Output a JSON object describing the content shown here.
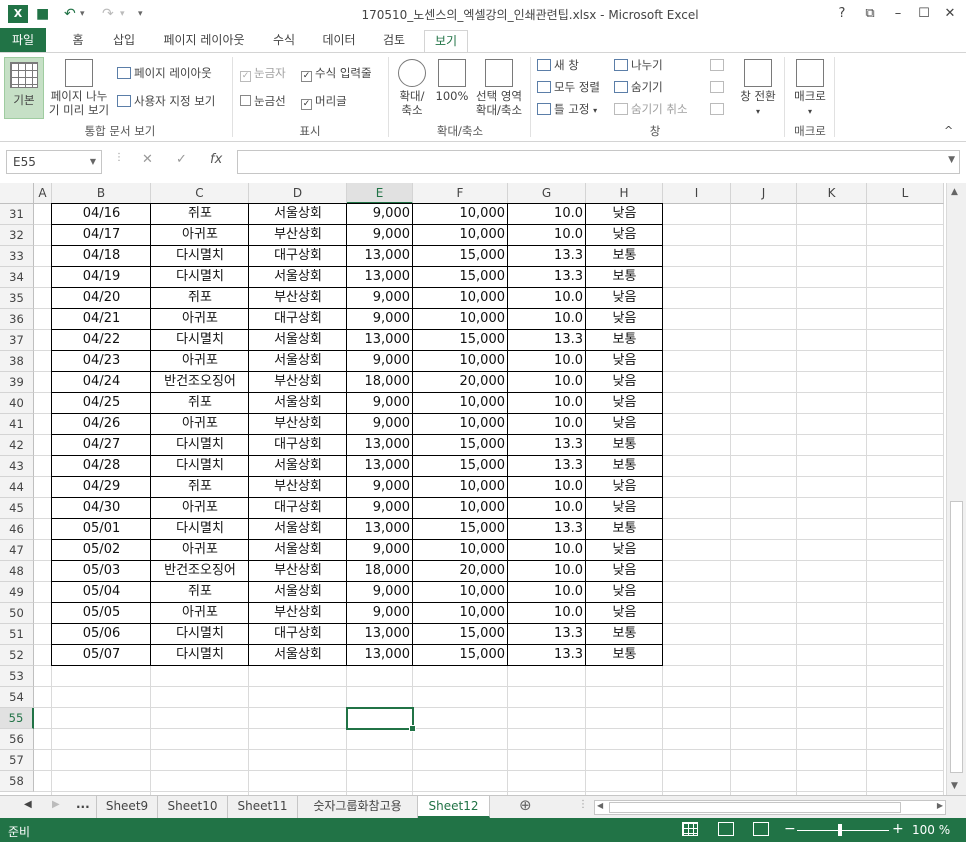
{
  "window": {
    "title": "170510_노센스의_엑셀강의_인쇄관련팁.xlsx - Microsoft Excel",
    "app_icon": "X",
    "help": "?",
    "restore_ribbon": "⧉",
    "minimize": "–",
    "maximize": "☐",
    "close": "✕"
  },
  "quick_access": {
    "save_icon": "💾",
    "undo": "↶",
    "redo": "↷",
    "more": "▾"
  },
  "tabs": [
    "파일",
    "홈",
    "삽입",
    "페이지 레이아웃",
    "수식",
    "데이터",
    "검토",
    "보기"
  ],
  "active_tab": "보기",
  "ribbon": {
    "workbook_views": {
      "label": "통합 문서 보기",
      "normal": "기본",
      "page_break_preview_1": "페이지 나누",
      "page_break_preview_2": "기 미리 보기",
      "page_layout": "페이지 레이아웃",
      "custom_views": "사용자 지정 보기"
    },
    "show": {
      "label": "표시",
      "ruler": "눈금자",
      "formula_bar": "수식 입력줄",
      "gridlines": "눈금선",
      "headings": "머리글"
    },
    "zoom": {
      "label": "확대/축소",
      "zoom_1": "확대/",
      "zoom_2": "축소",
      "hundred": "100%",
      "zoom_sel_1": "선택 영역",
      "zoom_sel_2": "확대/축소"
    },
    "window": {
      "label": "창",
      "new_window": "새 창",
      "arrange_all": "모두 정렬",
      "freeze": "틀 고정",
      "split": "나누기",
      "hide": "숨기기",
      "unhide": "숨기기 취소",
      "switch_1": "창 전환"
    },
    "macros": {
      "label": "매크로",
      "macros": "매크로"
    },
    "collapse": "^"
  },
  "formula_bar": {
    "name_box": "E55",
    "cancel": "✕",
    "enter": "✓",
    "fx": "fx",
    "value": ""
  },
  "columns": [
    "A",
    "B",
    "C",
    "D",
    "E",
    "F",
    "G",
    "H",
    "I",
    "J",
    "K",
    "L"
  ],
  "selected_column": "E",
  "selected_row": "55",
  "rows_labels": [
    "31",
    "32",
    "33",
    "34",
    "35",
    "36",
    "37",
    "38",
    "39",
    "40",
    "41",
    "42",
    "43",
    "44",
    "45",
    "46",
    "47",
    "48",
    "49",
    "50",
    "51",
    "52",
    "53",
    "54",
    "55",
    "56",
    "57",
    "58"
  ],
  "table_rows": [
    [
      "04/16",
      "쥐포",
      "서울상회",
      "9,000",
      "10,000",
      "10.0",
      "낮음"
    ],
    [
      "04/17",
      "아귀포",
      "부산상회",
      "9,000",
      "10,000",
      "10.0",
      "낮음"
    ],
    [
      "04/18",
      "다시멸치",
      "대구상회",
      "13,000",
      "15,000",
      "13.3",
      "보통"
    ],
    [
      "04/19",
      "다시멸치",
      "서울상회",
      "13,000",
      "15,000",
      "13.3",
      "보통"
    ],
    [
      "04/20",
      "쥐포",
      "부산상회",
      "9,000",
      "10,000",
      "10.0",
      "낮음"
    ],
    [
      "04/21",
      "아귀포",
      "대구상회",
      "9,000",
      "10,000",
      "10.0",
      "낮음"
    ],
    [
      "04/22",
      "다시멸치",
      "서울상회",
      "13,000",
      "15,000",
      "13.3",
      "보통"
    ],
    [
      "04/23",
      "아귀포",
      "서울상회",
      "9,000",
      "10,000",
      "10.0",
      "낮음"
    ],
    [
      "04/24",
      "반건조오징어",
      "부산상회",
      "18,000",
      "20,000",
      "10.0",
      "낮음"
    ],
    [
      "04/25",
      "쥐포",
      "서울상회",
      "9,000",
      "10,000",
      "10.0",
      "낮음"
    ],
    [
      "04/26",
      "아귀포",
      "부산상회",
      "9,000",
      "10,000",
      "10.0",
      "낮음"
    ],
    [
      "04/27",
      "다시멸치",
      "대구상회",
      "13,000",
      "15,000",
      "13.3",
      "보통"
    ],
    [
      "04/28",
      "다시멸치",
      "서울상회",
      "13,000",
      "15,000",
      "13.3",
      "보통"
    ],
    [
      "04/29",
      "쥐포",
      "부산상회",
      "9,000",
      "10,000",
      "10.0",
      "낮음"
    ],
    [
      "04/30",
      "아귀포",
      "대구상회",
      "9,000",
      "10,000",
      "10.0",
      "낮음"
    ],
    [
      "05/01",
      "다시멸치",
      "서울상회",
      "13,000",
      "15,000",
      "13.3",
      "보통"
    ],
    [
      "05/02",
      "아귀포",
      "서울상회",
      "9,000",
      "10,000",
      "10.0",
      "낮음"
    ],
    [
      "05/03",
      "반건조오징어",
      "부산상회",
      "18,000",
      "20,000",
      "10.0",
      "낮음"
    ],
    [
      "05/04",
      "쥐포",
      "서울상회",
      "9,000",
      "10,000",
      "10.0",
      "낮음"
    ],
    [
      "05/05",
      "아귀포",
      "부산상회",
      "9,000",
      "10,000",
      "10.0",
      "낮음"
    ],
    [
      "05/06",
      "다시멸치",
      "대구상회",
      "13,000",
      "15,000",
      "13.3",
      "보통"
    ],
    [
      "05/07",
      "다시멸치",
      "서울상회",
      "13,000",
      "15,000",
      "13.3",
      "보통"
    ]
  ],
  "sheet_tabs": [
    "Sheet9",
    "Sheet10",
    "Sheet11",
    "숫자그룹화참고용",
    "Sheet12"
  ],
  "active_sheet": "Sheet12",
  "sheet_nav": {
    "prev": "◀",
    "next": "▶",
    "more": "...",
    "add": "⊕"
  },
  "status": {
    "ready": "준비",
    "zoom": "100 %",
    "zoom_minus": "−",
    "zoom_plus": "+"
  },
  "colors": {
    "excel_green": "#217346",
    "selected_header": "#e1e1e1"
  }
}
